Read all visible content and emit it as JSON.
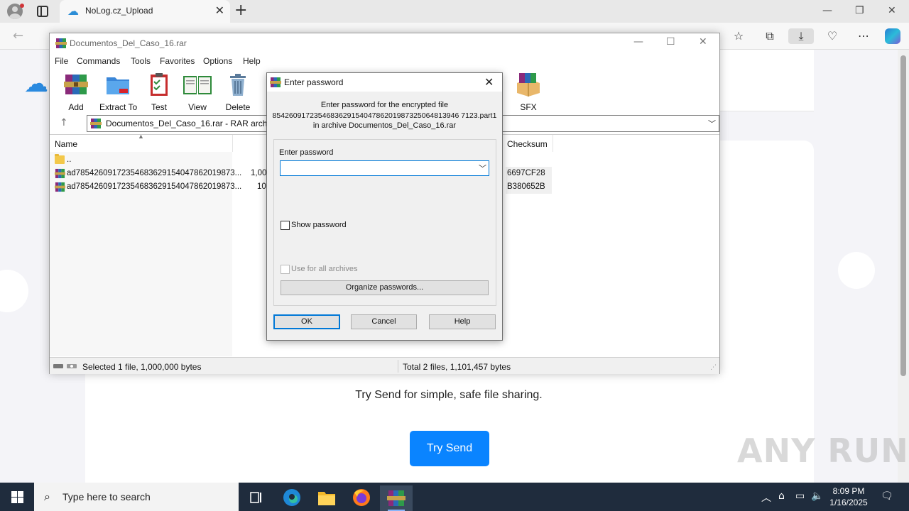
{
  "browser": {
    "tab_title": "NoLog.cz_Upload",
    "tab_icon": "cloud-upload-icon",
    "page": {
      "tagline": "Try Send for simple, safe file sharing.",
      "cta_button": "Try Send"
    },
    "watermark": "ANY RUN"
  },
  "winrar": {
    "title": "Documentos_Del_Caso_16.rar",
    "menu": [
      "File",
      "Commands",
      "Tools",
      "Favorites",
      "Options",
      "Help"
    ],
    "toolbar": [
      {
        "label": "Add",
        "icon": "add-archive-icon"
      },
      {
        "label": "Extract To",
        "icon": "extract-to-icon"
      },
      {
        "label": "Test",
        "icon": "test-clipboard-icon"
      },
      {
        "label": "View",
        "icon": "view-book-icon"
      },
      {
        "label": "Delete",
        "icon": "delete-trash-icon"
      },
      {
        "label": "SFX",
        "icon": "sfx-box-icon"
      }
    ],
    "path": "Documentos_Del_Caso_16.rar - RAR archive",
    "columns": {
      "name": "Name",
      "checksum": "Checksum"
    },
    "rows": [
      {
        "name": "..",
        "size": "",
        "checksum": ""
      },
      {
        "name": "ad78542609172354683629154047862019873...",
        "size": "1,000",
        "checksum": "6697CF28"
      },
      {
        "name": "ad78542609172354683629154047862019873...",
        "size": "10",
        "checksum": "B380652B"
      }
    ],
    "status_left": "Selected 1 file, 1,000,000 bytes",
    "status_right": "Total 2 files, 1,101,457 bytes"
  },
  "dialog": {
    "title": "Enter password",
    "message_line1": "Enter password for the encrypted file",
    "message_line2": "854260917235468362915404786201987325064813946 7123.part1",
    "message_line3": "in archive Documentos_Del_Caso_16.rar",
    "password_label": "Enter password",
    "password_value": "",
    "show_password": "Show password",
    "use_for_all": "Use for all archives",
    "organize": "Organize passwords...",
    "ok": "OK",
    "cancel": "Cancel",
    "help": "Help"
  },
  "taskbar": {
    "search_placeholder": "Type here to search",
    "time": "8:09 PM",
    "date": "1/16/2025"
  },
  "colors": {
    "accent": "#0a84ff",
    "taskbar": "#1f2c3d",
    "focus": "#0078d7"
  }
}
